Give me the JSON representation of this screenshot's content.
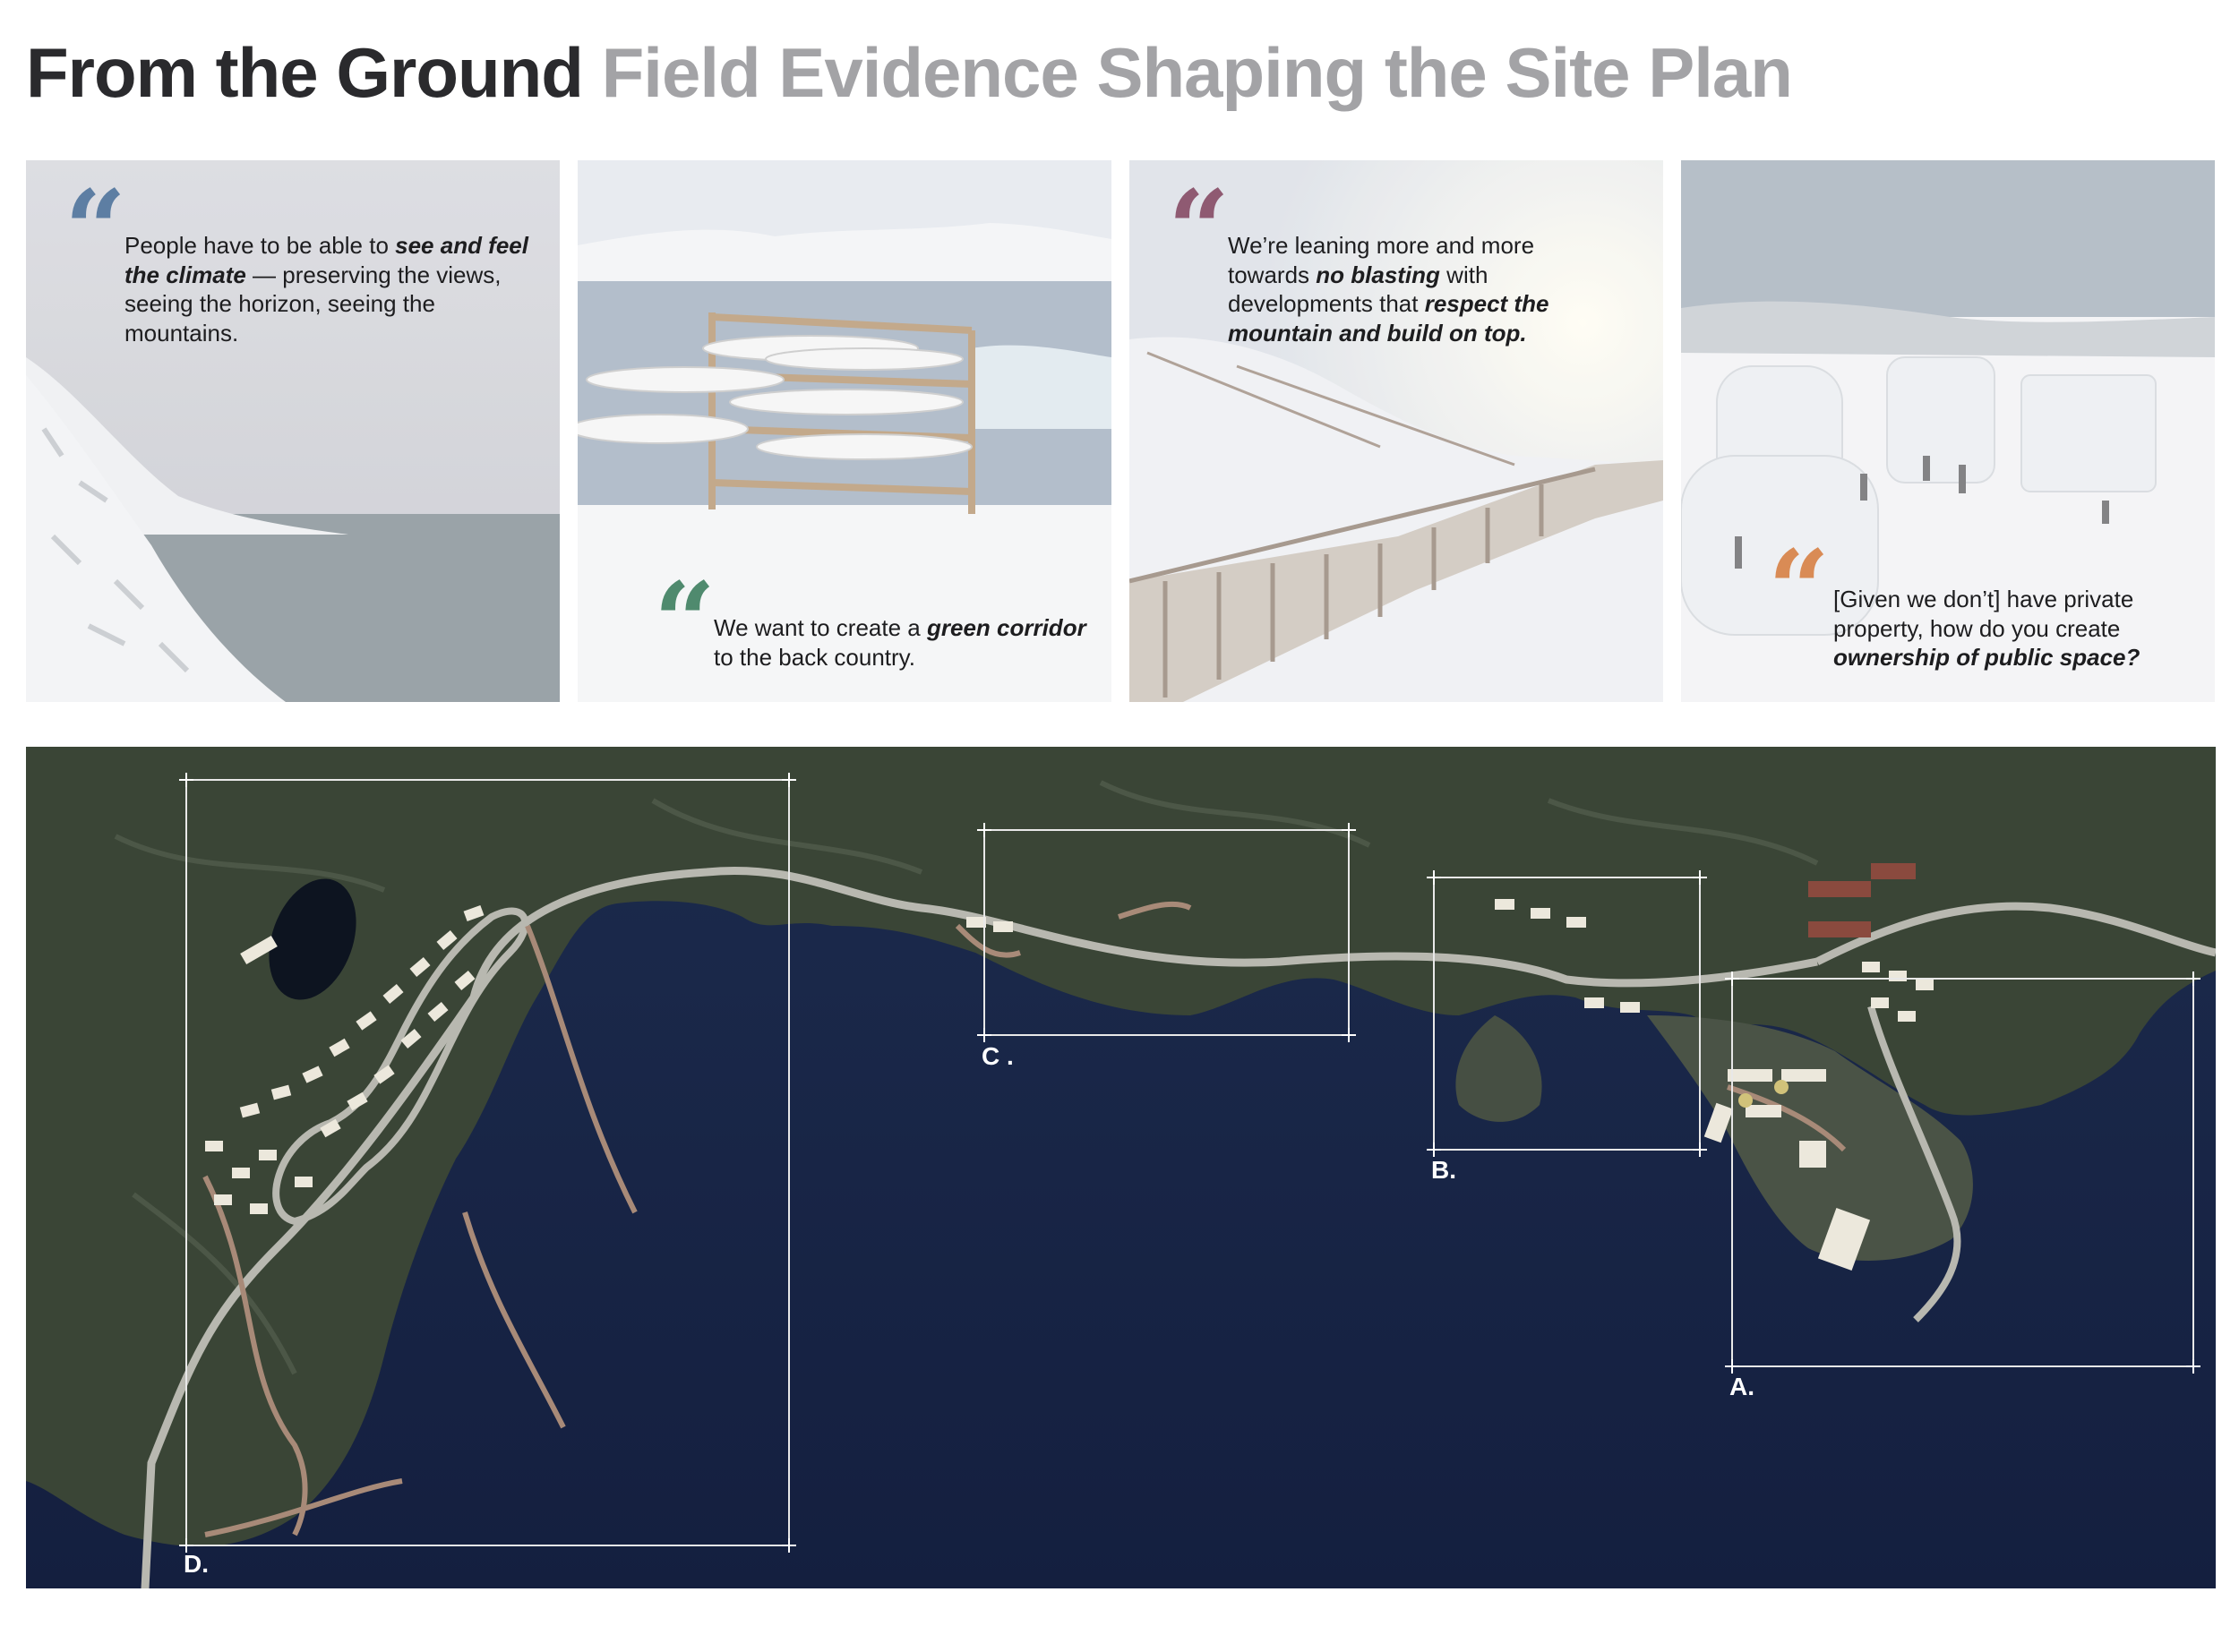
{
  "header": {
    "title_main": "From the Ground",
    "title_sub": "Field Evidence Shaping the Site Plan"
  },
  "quotes": [
    {
      "icon": "quote-icon",
      "color": "#5d7ea3",
      "parts": [
        {
          "text": "People have to be able to ",
          "em": false
        },
        {
          "text": "see and feel the climate",
          "em": true
        },
        {
          "text": " — preserving the views, seeing the horizon, seeing the mountains.",
          "em": false
        }
      ]
    },
    {
      "icon": "quote-icon",
      "color": "#4f8a6e",
      "parts": [
        {
          "text": "We want to create a ",
          "em": false
        },
        {
          "text": "green corridor",
          "em": true
        },
        {
          "text": " to the back country.",
          "em": false
        }
      ]
    },
    {
      "icon": "quote-icon",
      "color": "#8f5a72",
      "parts": [
        {
          "text": "We’re leaning more and more towards ",
          "em": false
        },
        {
          "text": "no blasting",
          "em": true
        },
        {
          "text": " with developments that ",
          "em": false
        },
        {
          "text": "respect the mountain and build on top.",
          "em": true
        }
      ]
    },
    {
      "icon": "quote-icon",
      "color": "#d98b55",
      "parts": [
        {
          "text": "[Given we don’t] have private property, how do you create ",
          "em": false
        },
        {
          "text": "ownership of public space?",
          "em": true
        }
      ]
    }
  ],
  "map": {
    "zones": [
      "D.",
      "C .",
      "B.",
      "A."
    ]
  },
  "colors": {
    "sea": "#1a2747",
    "land": "#3a4536",
    "path": "#a88a78",
    "road": "#b8b8b0",
    "building": "#ece8dc"
  }
}
